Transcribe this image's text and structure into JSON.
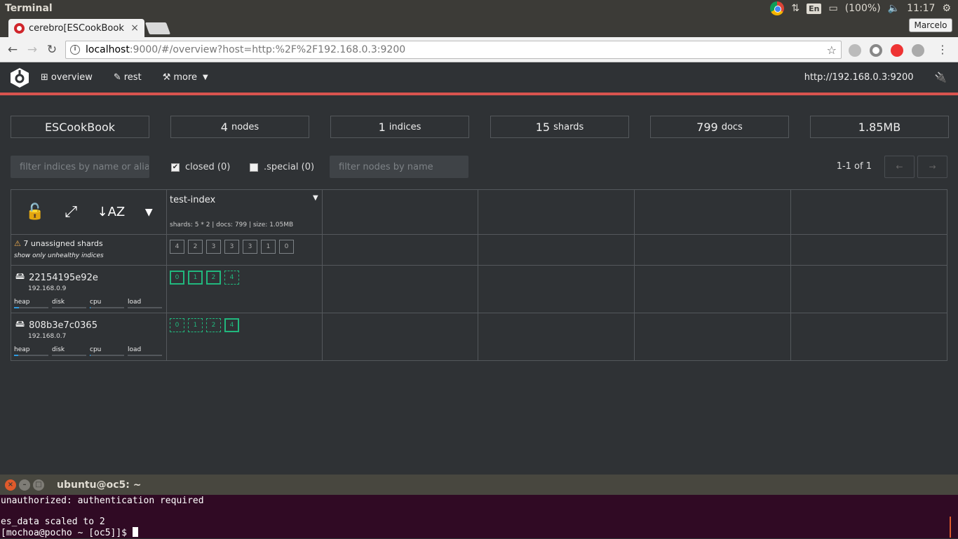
{
  "os": {
    "app_title": "Terminal",
    "lang": "En",
    "battery": "(100%)",
    "clock": "11:17"
  },
  "browser": {
    "tab_title": "cerebro[ESCookBook",
    "profile": "Marcelo",
    "url_host": "localhost",
    "url_rest": ":9000/#/overview?host=http:%2F%2F192.168.0.3:9200"
  },
  "nav": {
    "overview": "overview",
    "rest": "rest",
    "more": "more",
    "host": "http://192.168.0.3:9200"
  },
  "stats": {
    "cluster": "ESCookBook",
    "nodes_value": "4",
    "nodes_unit": "nodes",
    "indices_value": "1",
    "indices_unit": "indices",
    "shards_value": "15",
    "shards_unit": "shards",
    "docs_value": "799",
    "docs_unit": "docs",
    "size": "1.85MB"
  },
  "filters": {
    "indices_placeholder": "filter indices by name or aliases",
    "closed_label": "closed (0)",
    "special_label": ".special (0)",
    "nodes_placeholder": "filter nodes by name",
    "pager": "1-1 of 1",
    "prev": "←",
    "next": "→"
  },
  "index": {
    "name": "test-index",
    "meta": "shards: 5 * 2 | docs: 799 | size: 1.05MB"
  },
  "unassigned": {
    "label": "7 unassigned shards",
    "unhealthy": "show only unhealthy indices",
    "shards": [
      "4",
      "2",
      "3",
      "3",
      "3",
      "1",
      "0"
    ]
  },
  "nodes": [
    {
      "name": "22154195e92e",
      "ip": "192.168.0.9",
      "metrics": [
        {
          "label": "heap",
          "value": 0.15
        },
        {
          "label": "disk",
          "value": 0
        },
        {
          "label": "cpu",
          "value": 0.03
        },
        {
          "label": "load",
          "value": 0
        }
      ],
      "shards": [
        {
          "id": "0",
          "type": "primary"
        },
        {
          "id": "1",
          "type": "primary"
        },
        {
          "id": "2",
          "type": "primary"
        },
        {
          "id": "4",
          "type": "replica"
        }
      ]
    },
    {
      "name": "808b3e7c0365",
      "ip": "192.168.0.7",
      "metrics": [
        {
          "label": "heap",
          "value": 0.12
        },
        {
          "label": "disk",
          "value": 0
        },
        {
          "label": "cpu",
          "value": 0.03
        },
        {
          "label": "load",
          "value": 0
        }
      ],
      "shards": [
        {
          "id": "0",
          "type": "replica"
        },
        {
          "id": "1",
          "type": "replica"
        },
        {
          "id": "2",
          "type": "replica"
        },
        {
          "id": "4",
          "type": "primary"
        }
      ]
    }
  ],
  "terminal": {
    "title": "ubuntu@oc5: ~",
    "line1": "unauthorized: authentication required",
    "line2": "",
    "line3": "es_data scaled to 2",
    "prompt": "[mochoa@pocho ~ [oc5]]$ "
  },
  "colors": {
    "accent": "#d9534f",
    "shard_green": "#21b77d",
    "metric_blue": "#2e9bdf",
    "warning": "#f0ad4e"
  }
}
